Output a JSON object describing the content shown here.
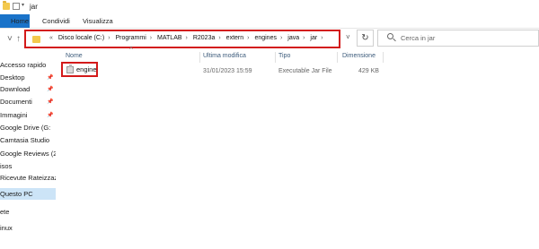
{
  "window": {
    "title": "jar"
  },
  "ribbon": {
    "tabs": [
      {
        "label": "Home"
      },
      {
        "label": "Condividi"
      },
      {
        "label": "Visualizza"
      }
    ]
  },
  "address": {
    "prefix": "«",
    "crumbs": [
      "Disco locale (C:)",
      "Programmi",
      "MATLAB",
      "R2023a",
      "extern",
      "engines",
      "java",
      "jar"
    ],
    "separator": "›"
  },
  "search": {
    "placeholder": "Cerca in jar"
  },
  "columns": {
    "name": "Nome",
    "modified": "Ultima modifica",
    "type": "Tipo",
    "size": "Dimensione"
  },
  "files": [
    {
      "name": "engine",
      "modified": "31/01/2023 15:59",
      "type": "Executable Jar File",
      "size": "429 KB"
    }
  ],
  "sidebar": {
    "items": [
      {
        "label": "Accesso rapido"
      },
      {
        "label": "Desktop"
      },
      {
        "label": "Download"
      },
      {
        "label": "Documenti"
      },
      {
        "label": "Immagini"
      },
      {
        "label": "Google Drive (G:"
      },
      {
        "label": "Camtasia Studio"
      },
      {
        "label": "Google Reviews (2)"
      },
      {
        "label": "isos"
      },
      {
        "label": "Ricevute Rateizzazio"
      },
      {
        "label": "Questo PC"
      },
      {
        "label": "ete"
      },
      {
        "label": "inux"
      }
    ]
  },
  "colors": {
    "accent": "#1a73c9",
    "highlight": "#d31a1a",
    "selected": "#cce4f7",
    "folder": "#f3c94d"
  }
}
